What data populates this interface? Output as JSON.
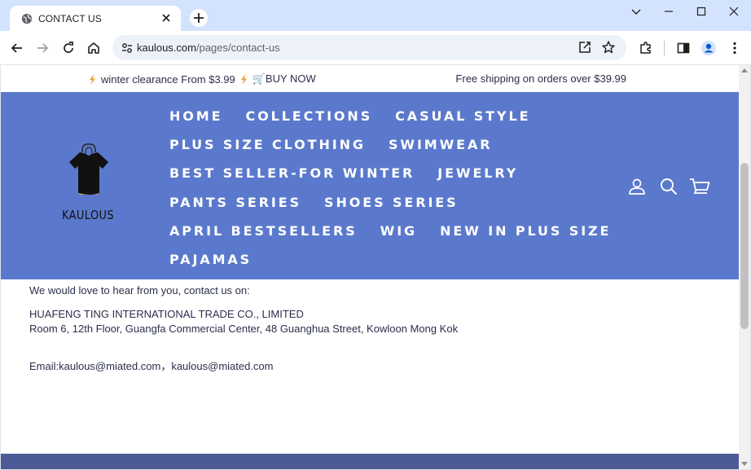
{
  "browser": {
    "tab_title": "CONTACT US",
    "url_host": "kaulous.com",
    "url_path": "/pages/contact-us",
    "icons": [
      "globe-icon",
      "close-icon",
      "plus-icon",
      "chevron-down-icon",
      "minimize-icon",
      "maximize-icon",
      "close-icon",
      "back-arrow-icon",
      "forward-arrow-icon",
      "reload-icon",
      "home-icon",
      "site-settings-icon",
      "share-icon",
      "star-icon",
      "extensions-icon",
      "side-panel-icon",
      "profile-icon",
      "kebab-menu-icon"
    ]
  },
  "announcement": {
    "promo_text": "winter clearance From $3.99",
    "buy_now": "🛒BUY NOW",
    "shipping": "Free shipping on orders over $39.99"
  },
  "header": {
    "logo_text": "KAULOUS",
    "nav_rows": [
      [
        "HOME",
        "COLLECTIONS",
        "CASUAL STYLE"
      ],
      [
        "PLUS SIZE CLOTHING",
        "SWIMWEAR"
      ],
      [
        "BEST SELLER-FOR WINTER",
        "JEWELRY"
      ],
      [
        "PANTS SERIES",
        "SHOES SERIES"
      ],
      [
        "APRIL BESTSELLERS",
        "WIG",
        "NEW IN PLUS SIZE"
      ],
      [
        "PAJAMAS"
      ]
    ],
    "icons": [
      "account-icon",
      "search-icon",
      "cart-icon"
    ]
  },
  "content": {
    "intro": "We would love to hear from you, contact us on:",
    "company": "HUAFENG TING INTERNATIONAL TRADE CO., LIMITED",
    "address": "Room 6, 12th Floor, Guangfa Commercial Center, 48 Guanghua Street, Kowloon Mong Kok",
    "email": "Email:kaulous@miated.com，kaulous@miated.com"
  },
  "colors": {
    "header_bg": "#5b79cc",
    "text": "#2b2f4a",
    "footer": "#4c5a96",
    "chrome": "#d3e3fd",
    "bolt": "#f0a33a"
  }
}
